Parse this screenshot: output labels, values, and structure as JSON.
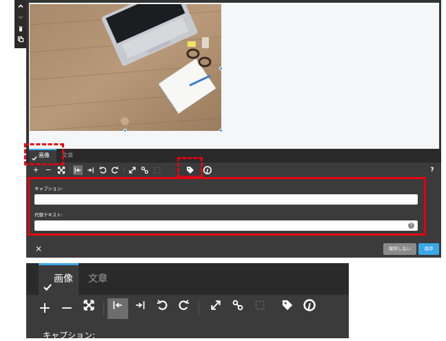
{
  "side_toolbar": {
    "items": [
      {
        "icon": "chevron-up-icon"
      },
      {
        "icon": "chevron-down-icon"
      },
      {
        "icon": "trash-icon"
      },
      {
        "icon": "copy-icon"
      }
    ]
  },
  "tabs": [
    {
      "label": "画像",
      "active": true,
      "icon": "check-icon"
    },
    {
      "label": "文章",
      "active": false
    }
  ],
  "toolbar": {
    "items": [
      {
        "icon": "zoom-in-icon",
        "glyph": "+"
      },
      {
        "icon": "zoom-out-icon",
        "glyph": "−"
      },
      {
        "icon": "fit-icon"
      },
      {
        "icon": "align-left-icon",
        "active": true
      },
      {
        "icon": "align-right-icon"
      },
      {
        "icon": "rotate-left-icon"
      },
      {
        "icon": "rotate-right-icon"
      },
      {
        "icon": "resize-icon"
      },
      {
        "icon": "link-icon"
      },
      {
        "icon": "unlink-icon",
        "disabled": true
      },
      {
        "icon": "tag-icon"
      },
      {
        "icon": "pinterest-icon"
      }
    ],
    "help": "?"
  },
  "fields": {
    "caption_label": "キャプション:",
    "caption_value": "",
    "alt_label": "代替テキスト:",
    "alt_value": ""
  },
  "footer": {
    "close": "×",
    "cancel": "保存しない",
    "save": "保存"
  },
  "zoom": {
    "caption_label": "キャプション:"
  },
  "colors": {
    "accent": "#3ba7e8",
    "annotation": "#e60012",
    "panel": "#3b3b3b",
    "tabbar": "#2a2a2a"
  }
}
